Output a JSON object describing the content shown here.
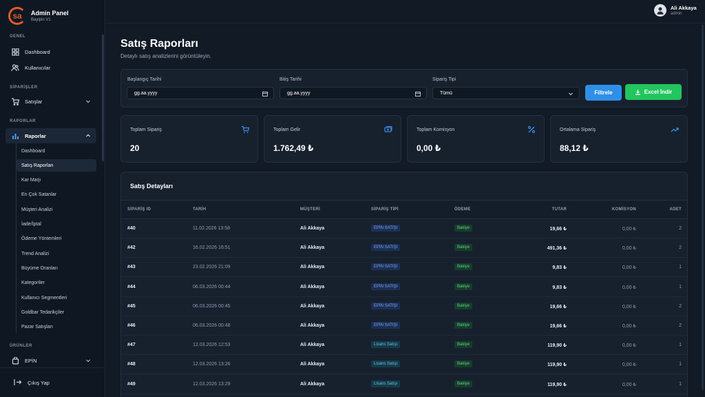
{
  "brand": {
    "title": "Admin Panel",
    "subtitle": "Bayipin V1",
    "logo": "sa"
  },
  "sidebar": {
    "sections": {
      "genel": "GENEL",
      "siparisler": "SİPARİŞLER",
      "raporlar": "RAPORLAR",
      "urunler": "ÜRÜNLER"
    },
    "items": {
      "dashboard": "Dashboard",
      "kullanicilar": "Kullanıcılar",
      "satislar": "Satışlar",
      "raporlar": "Raporlar",
      "epin": "EPİN"
    },
    "report_items": [
      "Dashboard",
      "Satış Raporları",
      "Kar Marjı",
      "En Çok Satanlar",
      "Müşteri Analizi",
      "İade/İptal",
      "Ödeme Yöntemleri",
      "Trend Analizi",
      "Büyüme Oranları",
      "Kategoriler",
      "Kullanıcı Segmentleri",
      "Goldbar Tedarikçiler",
      "Pazar Satışları"
    ],
    "logout": "Çıkış Yap"
  },
  "user": {
    "name": "Ali Akkaya",
    "role": "admin"
  },
  "page": {
    "title": "Satış Raporları",
    "subtitle": "Detaylı satış analizlerini görüntüleyin."
  },
  "filters": {
    "start_label": "Başlangıç Tarihi",
    "start_value": "gg.aa.yyyy",
    "end_label": "Bitiş Tarihi",
    "end_value": "gg.aa.yyyy",
    "type_label": "Sipariş Tipi",
    "type_value": "Tümü",
    "filter_button": "Filtrele",
    "excel_button": "Excel İndir"
  },
  "stats": [
    {
      "label": "Toplam Sipariş",
      "value": "20",
      "icon": "cart-icon"
    },
    {
      "label": "Toplam Gelir",
      "value": "1.762,49 ₺",
      "icon": "money-icon"
    },
    {
      "label": "Toplam Komisyon",
      "value": "0,00 ₺",
      "icon": "percent-icon"
    },
    {
      "label": "Ortalama Sipariş",
      "value": "88,12 ₺",
      "icon": "trend-icon"
    }
  ],
  "table": {
    "title": "Satış Detayları",
    "headers": {
      "id": "SİPARİŞ ID",
      "date": "TARİH",
      "customer": "MÜŞTERİ",
      "type": "SİPARİŞ TİPİ",
      "payment": "ÖDEME",
      "amount": "TUTAR",
      "commission": "KOMİSYON",
      "qty": "ADET"
    },
    "rows": [
      {
        "id": "#40",
        "date": "11.02.2026 13:58",
        "customer": "Ali Akkaya",
        "type": "EPİN SATIŞI",
        "payment": "Bakiye",
        "amount": "19,66 ₺",
        "commission": "0,00 ₺",
        "qty": "2"
      },
      {
        "id": "#42",
        "date": "16.02.2026 16:51",
        "customer": "Ali Akkaya",
        "type": "EPİN SATIŞI",
        "payment": "Bakiye",
        "amount": "491,36 ₺",
        "commission": "0,00 ₺",
        "qty": "2"
      },
      {
        "id": "#43",
        "date": "23.02.2026 21:09",
        "customer": "Ali Akkaya",
        "type": "EPİN SATIŞI",
        "payment": "Bakiye",
        "amount": "9,83 ₺",
        "commission": "0,00 ₺",
        "qty": "1"
      },
      {
        "id": "#44",
        "date": "06.03.2026 00:44",
        "customer": "Ali Akkaya",
        "type": "EPİN SATIŞI",
        "payment": "Bakiye",
        "amount": "9,83 ₺",
        "commission": "0,00 ₺",
        "qty": "1"
      },
      {
        "id": "#45",
        "date": "06.03.2026 00:45",
        "customer": "Ali Akkaya",
        "type": "EPİN SATIŞI",
        "payment": "Bakiye",
        "amount": "19,66 ₺",
        "commission": "0,00 ₺",
        "qty": "2"
      },
      {
        "id": "#46",
        "date": "06.03.2026 00:48",
        "customer": "Ali Akkaya",
        "type": "EPİN SATIŞI",
        "payment": "Bakiye",
        "amount": "19,66 ₺",
        "commission": "0,00 ₺",
        "qty": "2"
      },
      {
        "id": "#47",
        "date": "12.03.2026 12:53",
        "customer": "Ali Akkaya",
        "type": "Lisans Satışı",
        "payment": "Bakiye",
        "amount": "119,90 ₺",
        "commission": "0,00 ₺",
        "qty": "1"
      },
      {
        "id": "#48",
        "date": "12.03.2026 13:26",
        "customer": "Ali Akkaya",
        "type": "Lisans Satışı",
        "payment": "Bakiye",
        "amount": "119,90 ₺",
        "commission": "0,00 ₺",
        "qty": "1"
      },
      {
        "id": "#49",
        "date": "12.03.2026 13:29",
        "customer": "Ali Akkaya",
        "type": "Lisans Satışı",
        "payment": "Bakiye",
        "amount": "119,90 ₺",
        "commission": "0,00 ₺",
        "qty": "1"
      }
    ]
  },
  "colors": {
    "accent_blue": "#2f8fe8",
    "accent_green": "#22c55e",
    "brand_orange": "#e05a2b"
  }
}
